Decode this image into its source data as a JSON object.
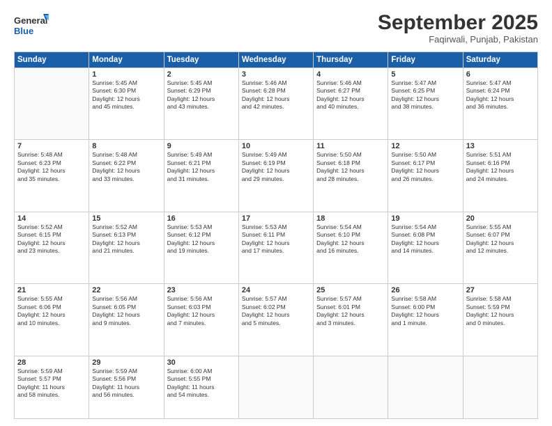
{
  "header": {
    "logo_general": "General",
    "logo_blue": "Blue",
    "month_title": "September 2025",
    "location": "Faqirwali, Punjab, Pakistan"
  },
  "weekdays": [
    "Sunday",
    "Monday",
    "Tuesday",
    "Wednesday",
    "Thursday",
    "Friday",
    "Saturday"
  ],
  "weeks": [
    [
      {
        "day": "",
        "content": ""
      },
      {
        "day": "1",
        "content": "Sunrise: 5:45 AM\nSunset: 6:30 PM\nDaylight: 12 hours\nand 45 minutes."
      },
      {
        "day": "2",
        "content": "Sunrise: 5:45 AM\nSunset: 6:29 PM\nDaylight: 12 hours\nand 43 minutes."
      },
      {
        "day": "3",
        "content": "Sunrise: 5:46 AM\nSunset: 6:28 PM\nDaylight: 12 hours\nand 42 minutes."
      },
      {
        "day": "4",
        "content": "Sunrise: 5:46 AM\nSunset: 6:27 PM\nDaylight: 12 hours\nand 40 minutes."
      },
      {
        "day": "5",
        "content": "Sunrise: 5:47 AM\nSunset: 6:25 PM\nDaylight: 12 hours\nand 38 minutes."
      },
      {
        "day": "6",
        "content": "Sunrise: 5:47 AM\nSunset: 6:24 PM\nDaylight: 12 hours\nand 36 minutes."
      }
    ],
    [
      {
        "day": "7",
        "content": "Sunrise: 5:48 AM\nSunset: 6:23 PM\nDaylight: 12 hours\nand 35 minutes."
      },
      {
        "day": "8",
        "content": "Sunrise: 5:48 AM\nSunset: 6:22 PM\nDaylight: 12 hours\nand 33 minutes."
      },
      {
        "day": "9",
        "content": "Sunrise: 5:49 AM\nSunset: 6:21 PM\nDaylight: 12 hours\nand 31 minutes."
      },
      {
        "day": "10",
        "content": "Sunrise: 5:49 AM\nSunset: 6:19 PM\nDaylight: 12 hours\nand 29 minutes."
      },
      {
        "day": "11",
        "content": "Sunrise: 5:50 AM\nSunset: 6:18 PM\nDaylight: 12 hours\nand 28 minutes."
      },
      {
        "day": "12",
        "content": "Sunrise: 5:50 AM\nSunset: 6:17 PM\nDaylight: 12 hours\nand 26 minutes."
      },
      {
        "day": "13",
        "content": "Sunrise: 5:51 AM\nSunset: 6:16 PM\nDaylight: 12 hours\nand 24 minutes."
      }
    ],
    [
      {
        "day": "14",
        "content": "Sunrise: 5:52 AM\nSunset: 6:15 PM\nDaylight: 12 hours\nand 23 minutes."
      },
      {
        "day": "15",
        "content": "Sunrise: 5:52 AM\nSunset: 6:13 PM\nDaylight: 12 hours\nand 21 minutes."
      },
      {
        "day": "16",
        "content": "Sunrise: 5:53 AM\nSunset: 6:12 PM\nDaylight: 12 hours\nand 19 minutes."
      },
      {
        "day": "17",
        "content": "Sunrise: 5:53 AM\nSunset: 6:11 PM\nDaylight: 12 hours\nand 17 minutes."
      },
      {
        "day": "18",
        "content": "Sunrise: 5:54 AM\nSunset: 6:10 PM\nDaylight: 12 hours\nand 16 minutes."
      },
      {
        "day": "19",
        "content": "Sunrise: 5:54 AM\nSunset: 6:08 PM\nDaylight: 12 hours\nand 14 minutes."
      },
      {
        "day": "20",
        "content": "Sunrise: 5:55 AM\nSunset: 6:07 PM\nDaylight: 12 hours\nand 12 minutes."
      }
    ],
    [
      {
        "day": "21",
        "content": "Sunrise: 5:55 AM\nSunset: 6:06 PM\nDaylight: 12 hours\nand 10 minutes."
      },
      {
        "day": "22",
        "content": "Sunrise: 5:56 AM\nSunset: 6:05 PM\nDaylight: 12 hours\nand 9 minutes."
      },
      {
        "day": "23",
        "content": "Sunrise: 5:56 AM\nSunset: 6:03 PM\nDaylight: 12 hours\nand 7 minutes."
      },
      {
        "day": "24",
        "content": "Sunrise: 5:57 AM\nSunset: 6:02 PM\nDaylight: 12 hours\nand 5 minutes."
      },
      {
        "day": "25",
        "content": "Sunrise: 5:57 AM\nSunset: 6:01 PM\nDaylight: 12 hours\nand 3 minutes."
      },
      {
        "day": "26",
        "content": "Sunrise: 5:58 AM\nSunset: 6:00 PM\nDaylight: 12 hours\nand 1 minute."
      },
      {
        "day": "27",
        "content": "Sunrise: 5:58 AM\nSunset: 5:59 PM\nDaylight: 12 hours\nand 0 minutes."
      }
    ],
    [
      {
        "day": "28",
        "content": "Sunrise: 5:59 AM\nSunset: 5:57 PM\nDaylight: 11 hours\nand 58 minutes."
      },
      {
        "day": "29",
        "content": "Sunrise: 5:59 AM\nSunset: 5:56 PM\nDaylight: 11 hours\nand 56 minutes."
      },
      {
        "day": "30",
        "content": "Sunrise: 6:00 AM\nSunset: 5:55 PM\nDaylight: 11 hours\nand 54 minutes."
      },
      {
        "day": "",
        "content": ""
      },
      {
        "day": "",
        "content": ""
      },
      {
        "day": "",
        "content": ""
      },
      {
        "day": "",
        "content": ""
      }
    ]
  ]
}
